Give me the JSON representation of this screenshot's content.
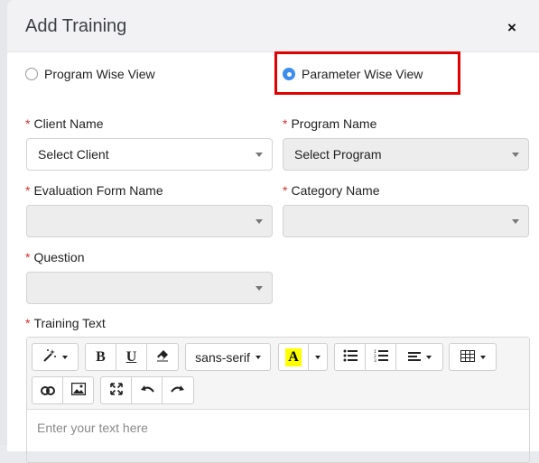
{
  "modal": {
    "title": "Add Training",
    "close_symbol": "×"
  },
  "view_mode": {
    "options": [
      {
        "label": "Program Wise View",
        "checked": false
      },
      {
        "label": "Parameter Wise View",
        "checked": true
      }
    ]
  },
  "form": {
    "required_mark": "*",
    "client": {
      "label": "Client Name",
      "value": "Select Client"
    },
    "program": {
      "label": "Program Name",
      "value": "Select Program"
    },
    "evaluation_form": {
      "label": "Evaluation Form Name",
      "value": ""
    },
    "category": {
      "label": "Category Name",
      "value": ""
    },
    "question": {
      "label": "Question",
      "value": ""
    },
    "training_text": {
      "label": "Training Text",
      "placeholder": "Enter your text here"
    }
  },
  "toolbar": {
    "bold": "B",
    "underline": "U",
    "font_family": "sans-serif",
    "text_color": "A",
    "text_color_hex": "#ffff00",
    "icons": [
      "magic-wand-icon",
      "eraser-icon",
      "unordered-list-icon",
      "ordered-list-icon",
      "align-icon",
      "table-icon",
      "link-icon",
      "picture-icon",
      "fullscreen-icon",
      "undo-icon",
      "redo-icon"
    ]
  },
  "colors": {
    "accent": "#3d8ef0",
    "highlight": "#e20000",
    "required": "#d32f2f"
  }
}
